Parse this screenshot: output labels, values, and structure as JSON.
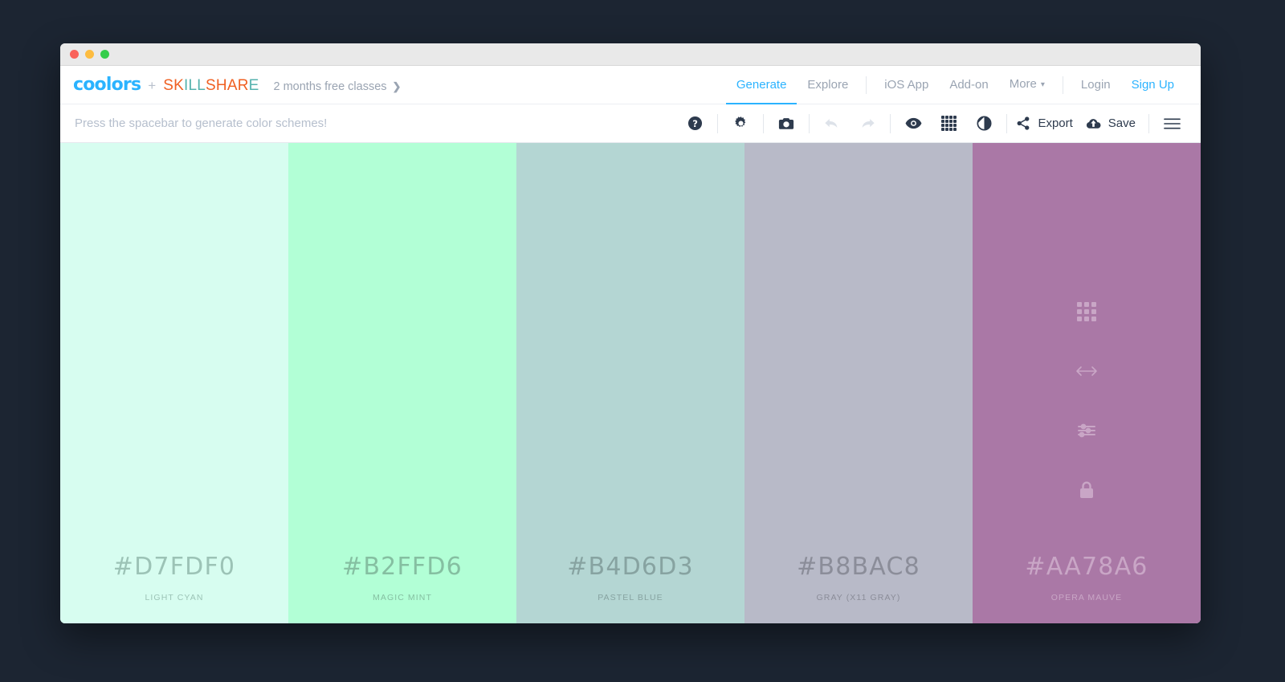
{
  "window": {
    "titlebar_buttons": [
      "close",
      "minimize",
      "maximize"
    ]
  },
  "header": {
    "logo": "coolors",
    "plus": "+",
    "partner": "SKILLSHARE",
    "partner_letters": [
      {
        "ch": "S",
        "c": "orange"
      },
      {
        "ch": "K",
        "c": "orange"
      },
      {
        "ch": "I",
        "c": "teal"
      },
      {
        "ch": "L",
        "c": "teal"
      },
      {
        "ch": "L",
        "c": "teal"
      },
      {
        "ch": "S",
        "c": "orange"
      },
      {
        "ch": "H",
        "c": "orange"
      },
      {
        "ch": "A",
        "c": "orange"
      },
      {
        "ch": "R",
        "c": "orange"
      },
      {
        "ch": "E",
        "c": "teal"
      }
    ],
    "promo": "2 months free classes",
    "promo_chevron": "❯",
    "nav_primary": [
      {
        "label": "Generate",
        "active": true
      },
      {
        "label": "Explore",
        "active": false
      }
    ],
    "nav_secondary": [
      {
        "label": "iOS App",
        "caret": false
      },
      {
        "label": "Add-on",
        "caret": false
      },
      {
        "label": "More",
        "caret": true
      }
    ],
    "nav_account": [
      {
        "label": "Login",
        "highlight": false
      },
      {
        "label": "Sign Up",
        "highlight": true
      }
    ],
    "caret_glyph": "▾",
    "accent_color": "#2bb3ff",
    "partner_orange": "#f06022",
    "partner_teal": "#55b2ae"
  },
  "toolbar": {
    "hint": "Press the spacebar to generate color schemes!",
    "icons_left": [
      {
        "name": "help-icon",
        "title": "Help"
      },
      {
        "name": "settings-gear-icon",
        "title": "Settings"
      },
      {
        "name": "camera-icon",
        "title": "Screenshot"
      }
    ],
    "history": [
      {
        "name": "undo-icon",
        "title": "Undo",
        "disabled": true
      },
      {
        "name": "redo-icon",
        "title": "Redo",
        "disabled": true
      }
    ],
    "view_icons": [
      {
        "name": "eye-icon",
        "title": "View"
      },
      {
        "name": "grid-icon",
        "title": "Grid view"
      },
      {
        "name": "contrast-icon",
        "title": "Contrast"
      }
    ],
    "export_label": "Export",
    "save_label": "Save",
    "menu_icon_name": "hamburger-menu-icon"
  },
  "palette": {
    "swatch_icon_names": [
      "drag-grid-icon",
      "resize-horizontal-icon",
      "adjust-sliders-icon",
      "lock-icon"
    ],
    "swatches": [
      {
        "hex": "#D7FDF0",
        "name": "LIGHT CYAN",
        "bg": "#d7fdf0",
        "text": "#9cc3b6",
        "show_icons": false
      },
      {
        "hex": "#B2FFD6",
        "name": "MAGIC MINT",
        "bg": "#b2ffd6",
        "text": "#85bfa1",
        "show_icons": false
      },
      {
        "hex": "#B4D6D3",
        "name": "PASTEL BLUE",
        "bg": "#b4d6d3",
        "text": "#87a3a1",
        "show_icons": false
      },
      {
        "hex": "#B8BAC8",
        "name": "GRAY (X11 GRAY)",
        "bg": "#b8bac8",
        "text": "#8b8d99",
        "show_icons": false
      },
      {
        "hex": "#AA78A6",
        "name": "OPERA MAUVE",
        "bg": "#aa78a6",
        "text": "#c9a6c6",
        "show_icons": true
      }
    ]
  }
}
